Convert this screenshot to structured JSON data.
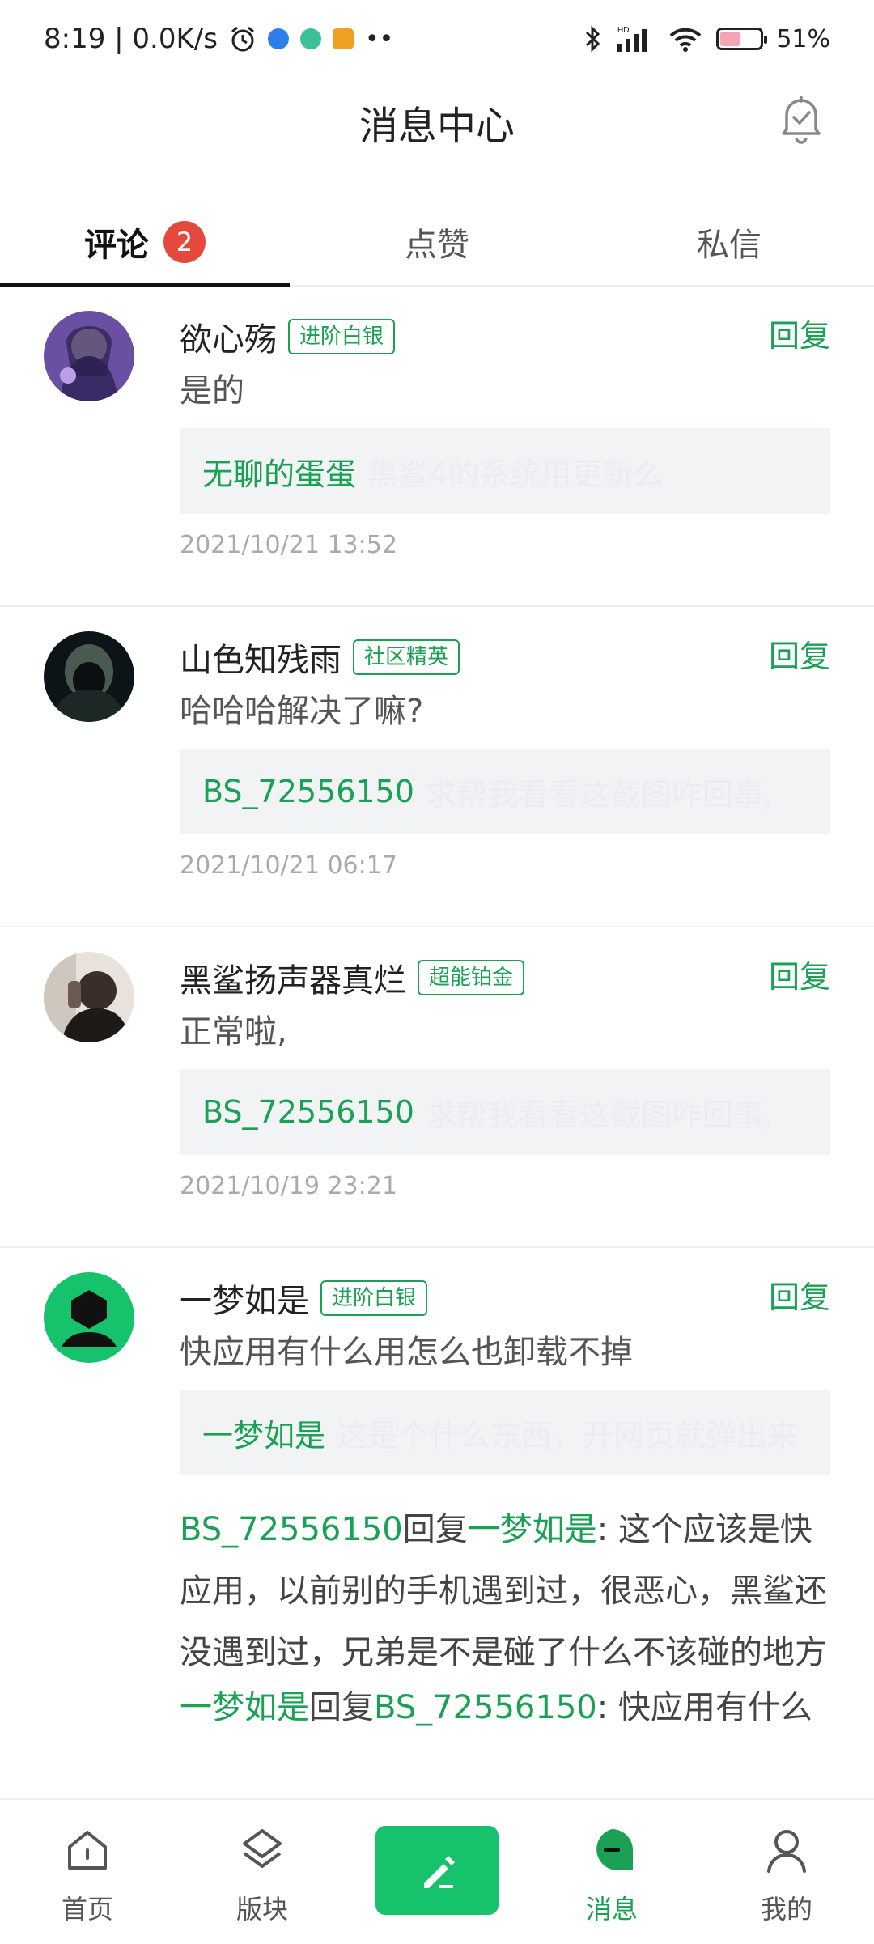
{
  "status_bar": {
    "time_speed": "8:19 | 0.0K/s",
    "battery": "51%",
    "battery_level": 0.51
  },
  "header": {
    "title": "消息中心"
  },
  "tabs": [
    {
      "label": "评论",
      "badge": "2"
    },
    {
      "label": "点赞"
    },
    {
      "label": "私信"
    }
  ],
  "items": [
    {
      "username": "欲心殇",
      "badge": "进阶白银",
      "reply_label": "回复",
      "comment": "是的",
      "quote_user": "无聊的蛋蛋",
      "quote_text": "黑鲨4的系统用更新么",
      "timestamp": "2021/10/21 13:52"
    },
    {
      "username": "山色知残雨",
      "badge": "社区精英",
      "reply_label": "回复",
      "comment": "哈哈哈解决了嘛?",
      "quote_user": "BS_72556150",
      "quote_text": "求帮我看看这截图咋回事,",
      "timestamp": "2021/10/21 06:17"
    },
    {
      "username": "黑鲨扬声器真烂",
      "badge": "超能铂金",
      "reply_label": "回复",
      "comment": "正常啦,",
      "quote_user": "BS_72556150",
      "quote_text": "求帮我看看这截图咋回事,",
      "timestamp": "2021/10/19 23:21"
    },
    {
      "username": "一梦如是",
      "badge": "进阶白银",
      "reply_label": "回复",
      "comment": "快应用有什么用怎么也卸载不掉",
      "quote_user": "一梦如是",
      "quote_text": "这是个什么东西，开网页就弹出来",
      "thread": [
        {
          "from": "BS_72556150",
          "verb": "回复",
          "to": "一梦如是",
          "text": ": 这个应该是快应用，以前别的手机遇到过，很恶心，黑鲨还没遇到过，兄弟是不是碰了什么不该碰的地方"
        },
        {
          "from": "一梦如是",
          "verb": "回复",
          "to": "BS_72556150",
          "text": ": 快应用有什么"
        }
      ]
    }
  ],
  "bottom_nav": [
    {
      "label": "首页",
      "icon": "home-icon"
    },
    {
      "label": "版块",
      "icon": "layers-icon"
    },
    {
      "label": "",
      "icon": "compose-icon"
    },
    {
      "label": "消息",
      "icon": "message-icon"
    },
    {
      "label": "我的",
      "icon": "user-icon"
    }
  ],
  "colors": {
    "accent": "#1aa153",
    "compose": "#17c26c",
    "badge_red": "#e5493d"
  }
}
